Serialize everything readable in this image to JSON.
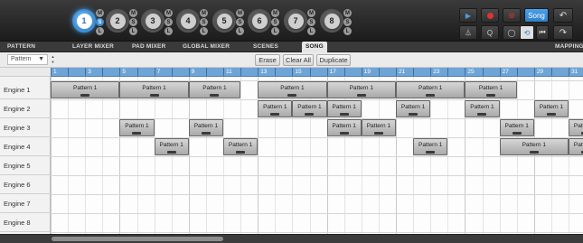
{
  "layers": [
    {
      "number": "1",
      "selected": true
    },
    {
      "number": "2",
      "selected": false
    },
    {
      "number": "3",
      "selected": false
    },
    {
      "number": "4",
      "selected": false
    },
    {
      "number": "5",
      "selected": false
    },
    {
      "number": "6",
      "selected": false
    },
    {
      "number": "7",
      "selected": false
    },
    {
      "number": "8",
      "selected": false
    }
  ],
  "layer_buttons": {
    "mute": "M",
    "solo": "S",
    "lock": "L"
  },
  "transport": {
    "play_icon": "▶",
    "record_icon": "record-icon",
    "rec_mode_icon": "⊚",
    "song_label": "Song",
    "undo_icon": "↶",
    "metronome_icon": "⏃",
    "quantize_label": "Q",
    "loop_icon": "◯",
    "follow_icon": "⟲",
    "back_icon": "⏮",
    "redo_icon": "↷"
  },
  "tabs": [
    {
      "label": "PATTERN",
      "active": false
    },
    {
      "label": "LAYER MIXER",
      "active": false
    },
    {
      "label": "PAD MIXER",
      "active": false
    },
    {
      "label": "GLOBAL MIXER",
      "active": false
    },
    {
      "label": "SCENES",
      "active": false
    },
    {
      "label": "SONG",
      "active": true
    },
    {
      "label": "MAPPING",
      "active": false
    }
  ],
  "toolbar": {
    "pattern_select_value": "Pattern",
    "erase_label": "Erase",
    "clear_all_label": "Clear All",
    "duplicate_label": "Duplicate"
  },
  "ruler": {
    "labels": [
      "1",
      "3",
      "5",
      "7",
      "9",
      "11",
      "13",
      "15",
      "17",
      "19",
      "21",
      "23",
      "25",
      "27",
      "29",
      "31"
    ]
  },
  "engines": [
    "Engine 1",
    "Engine 2",
    "Engine 3",
    "Engine 4",
    "Engine 5",
    "Engine 6",
    "Engine 7",
    "Engine 8"
  ],
  "clips": [
    {
      "engine": 0,
      "start": 1,
      "length": 4,
      "label": "Pattern 1"
    },
    {
      "engine": 0,
      "start": 5,
      "length": 4,
      "label": "Pattern 1"
    },
    {
      "engine": 0,
      "start": 9,
      "length": 3,
      "label": "Pattern 1"
    },
    {
      "engine": 0,
      "start": 13,
      "length": 4,
      "label": "Pattern 1"
    },
    {
      "engine": 0,
      "start": 17,
      "length": 4,
      "label": "Pattern 1"
    },
    {
      "engine": 0,
      "start": 21,
      "length": 4,
      "label": "Pattern 1"
    },
    {
      "engine": 0,
      "start": 25,
      "length": 3,
      "label": "Pattern 1"
    },
    {
      "engine": 1,
      "start": 13,
      "length": 2,
      "label": "Pattern 1"
    },
    {
      "engine": 1,
      "start": 15,
      "length": 2,
      "label": "Pattern 1"
    },
    {
      "engine": 1,
      "start": 17,
      "length": 2,
      "label": "Pattern 1"
    },
    {
      "engine": 1,
      "start": 21,
      "length": 2,
      "label": "Pattern 1"
    },
    {
      "engine": 1,
      "start": 25,
      "length": 2,
      "label": "Pattern 1"
    },
    {
      "engine": 1,
      "start": 29,
      "length": 2,
      "label": "Pattern 1"
    },
    {
      "engine": 2,
      "start": 5,
      "length": 2,
      "label": "Pattern 1"
    },
    {
      "engine": 2,
      "start": 9,
      "length": 2,
      "label": "Pattern 1"
    },
    {
      "engine": 2,
      "start": 17,
      "length": 2,
      "label": "Pattern 1"
    },
    {
      "engine": 2,
      "start": 19,
      "length": 2,
      "label": "Pattern 1"
    },
    {
      "engine": 2,
      "start": 27,
      "length": 2,
      "label": "Pattern 1"
    },
    {
      "engine": 2,
      "start": 31,
      "length": 2,
      "label": "Pattern 1"
    },
    {
      "engine": 3,
      "start": 7,
      "length": 2,
      "label": "Pattern 1"
    },
    {
      "engine": 3,
      "start": 11,
      "length": 2,
      "label": "Pattern 1"
    },
    {
      "engine": 3,
      "start": 22,
      "length": 2,
      "label": "Pattern 1"
    },
    {
      "engine": 3,
      "start": 27,
      "length": 4,
      "label": "Pattern 1"
    },
    {
      "engine": 3,
      "start": 31,
      "length": 2,
      "label": "Pattern 1"
    }
  ],
  "colors": {
    "accent": "#3e8fd6",
    "ruler": "#6fa5d6",
    "record": "#dd3333"
  }
}
